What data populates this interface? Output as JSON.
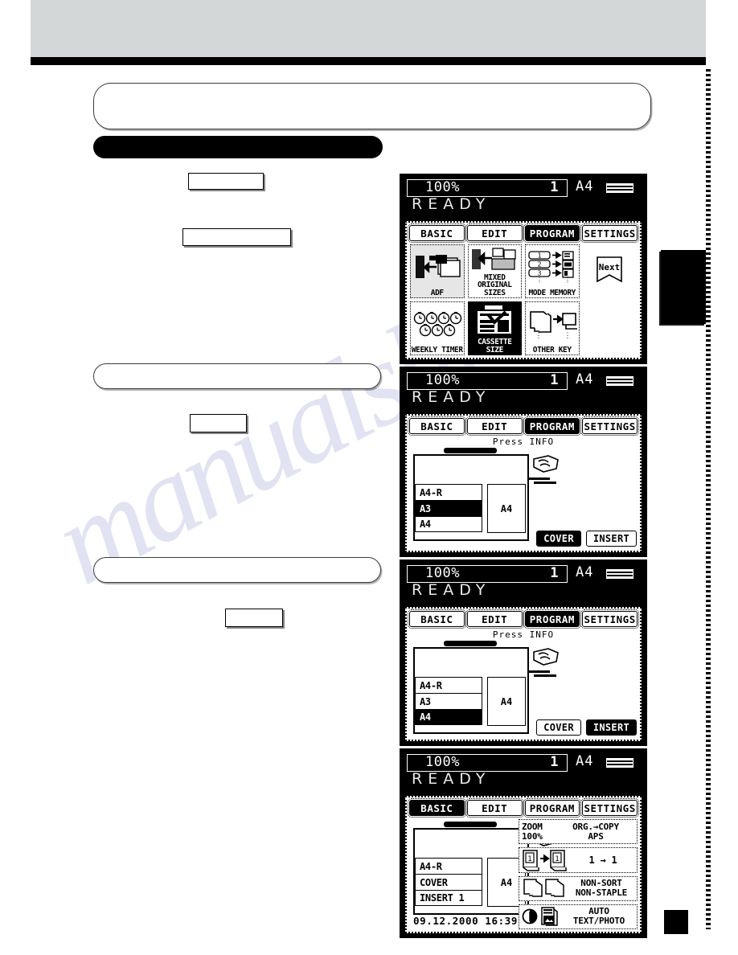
{
  "page": {
    "watermark_text": "manualshi",
    "header_band": "",
    "left_callouts": [
      {
        "name": "callout-1",
        "text": ""
      },
      {
        "name": "callout-2",
        "text": ""
      },
      {
        "name": "callout-3",
        "text": ""
      },
      {
        "name": "callout-4",
        "text": ""
      }
    ],
    "left_boxes": [
      {
        "name": "box-1",
        "text": ""
      },
      {
        "name": "box-2",
        "text": ""
      },
      {
        "name": "box-3",
        "text": ""
      },
      {
        "name": "box-4",
        "text": ""
      }
    ]
  },
  "common": {
    "zoom_ratio": "100%",
    "copy_qty": "1",
    "paper_size": "A4",
    "status": "READY",
    "tabs": [
      "BASIC",
      "EDIT",
      "PROGRAM",
      "SETTINGS"
    ],
    "press_info": "Press INFO"
  },
  "panel1": {
    "active_tab": "PROGRAM",
    "keys": [
      {
        "name": "adf-key",
        "label": "ADF",
        "icon": "adf-icon",
        "selected": false
      },
      {
        "name": "mixed-original-sizes-key",
        "label": "MIXED\nORIGINAL SIZES",
        "icon": "mixed-originals-icon",
        "selected": false
      },
      {
        "name": "mode-memory-key",
        "label": "MODE MEMORY",
        "icon": "mode-memory-icon",
        "selected": false,
        "rows": [
          "1",
          "2",
          "3"
        ],
        "ellipsis": "⋮"
      },
      {
        "name": "weekly-timer-key",
        "label": "WEEKLY TIMER",
        "icon": "clock-icon",
        "selected": false
      },
      {
        "name": "cassette-size-key",
        "label": "CASSETTE SIZE",
        "icon": "cassette-icon",
        "selected": true
      },
      {
        "name": "other-key-key",
        "label": "OTHER KEY",
        "icon": "other-key-icon",
        "selected": false
      }
    ],
    "next_tab_label": "Next"
  },
  "panel2": {
    "active_tab": "PROGRAM",
    "cassettes": [
      {
        "label": "A4-R",
        "selected": false
      },
      {
        "label": "A3",
        "selected": true
      },
      {
        "label": "A4",
        "selected": false
      }
    ],
    "bypass_label": "A4",
    "buttons": [
      {
        "name": "cover-button",
        "label": "COVER",
        "selected": true
      },
      {
        "name": "insert-button",
        "label": "INSERT",
        "selected": false
      }
    ]
  },
  "panel3": {
    "active_tab": "PROGRAM",
    "cassettes": [
      {
        "label": "A4-R",
        "selected": false
      },
      {
        "label": "A3",
        "selected": false
      },
      {
        "label": "A4",
        "selected": true
      }
    ],
    "bypass_label": "A4",
    "buttons": [
      {
        "name": "cover-button",
        "label": "COVER",
        "selected": false
      },
      {
        "name": "insert-button",
        "label": "INSERT",
        "selected": true
      }
    ]
  },
  "panel4": {
    "active_tab": "BASIC",
    "cassettes": [
      {
        "label": "A4-R",
        "selected": false
      },
      {
        "label": "COVER",
        "selected": false
      },
      {
        "label": "INSERT 1",
        "selected": false
      }
    ],
    "bypass_label": "A4",
    "datetime": "09.12.2000 16:39",
    "settings": [
      {
        "name": "zoom-setting",
        "line1": "ZOOM",
        "line2": "100%",
        "right1": "ORG.→COPY",
        "right2": "APS"
      },
      {
        "name": "duplex-setting",
        "text": "1  →  1"
      },
      {
        "name": "finisher-setting",
        "line1": "NON-SORT",
        "line2": "NON-STAPLE"
      },
      {
        "name": "image-mode-setting",
        "line1": "AUTO",
        "line2": "TEXT/PHOTO"
      }
    ]
  }
}
